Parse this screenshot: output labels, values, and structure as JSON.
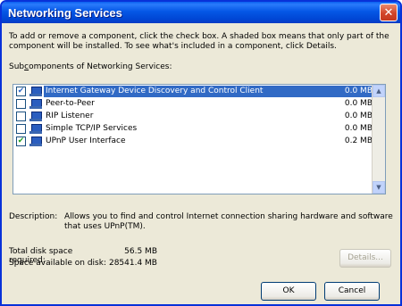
{
  "window": {
    "title": "Networking Services",
    "close_glyph": "✕"
  },
  "instructions": "To add or remove a component, click the check box. A shaded box means that only part of the component will be installed. To see what's included in a component, click Details.",
  "subcomponents_label": {
    "prefix": "Sub",
    "accel": "c",
    "rest": "omponents of Networking Services:"
  },
  "components": [
    {
      "name": "Internet Gateway Device Discovery and Control Client",
      "size": "0.0 MB",
      "checked": true,
      "selected": true
    },
    {
      "name": "Peer-to-Peer",
      "size": "0.0 MB",
      "checked": false,
      "selected": false
    },
    {
      "name": "RIP Listener",
      "size": "0.0 MB",
      "checked": false,
      "selected": false
    },
    {
      "name": "Simple TCP/IP Services",
      "size": "0.0 MB",
      "checked": false,
      "selected": false
    },
    {
      "name": "UPnP User Interface",
      "size": "0.2 MB",
      "checked": true,
      "selected": false
    }
  ],
  "description": {
    "label": "Description:",
    "text": "Allows you to find and control Internet connection sharing hardware and software that uses UPnP(TM)."
  },
  "disk": {
    "total_label": "Total disk space required:",
    "total_value": "56.5 MB",
    "avail_label": "Space available on disk:",
    "avail_value": "28541.4 MB"
  },
  "buttons": {
    "details": "Details...",
    "ok": "OK",
    "cancel": "Cancel"
  },
  "icons": {
    "check": "✔",
    "scroll_up": "▲",
    "scroll_down": "▼"
  },
  "colors": {
    "title_bar": "#0054e3",
    "selection": "#316ac5",
    "face": "#ece9d8"
  }
}
